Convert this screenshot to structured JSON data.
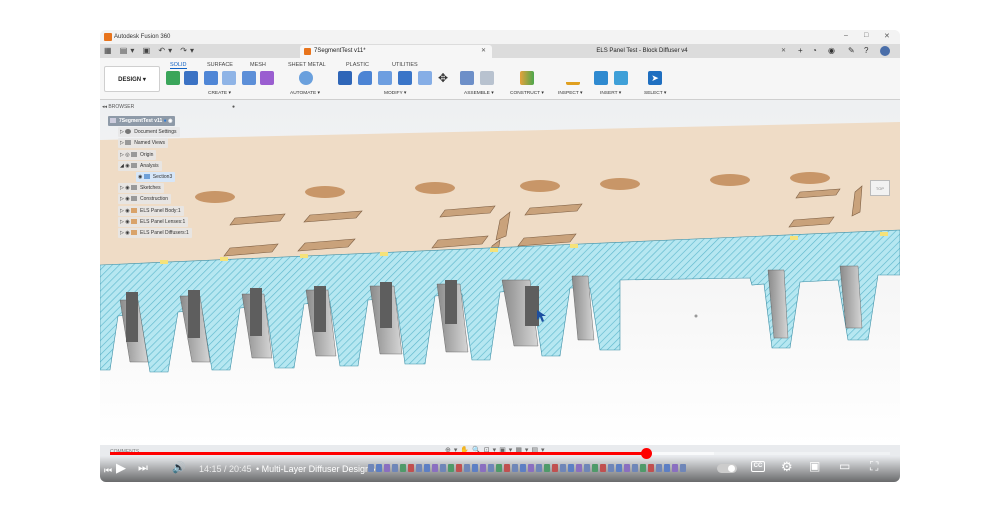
{
  "window": {
    "app_title": "Autodesk Fusion 360"
  },
  "tabs": [
    {
      "label": "7SegmentTest v11*",
      "active": true
    },
    {
      "label": "ELS Panel Test - Block Diffuser v4",
      "active": false
    }
  ],
  "ribbon": {
    "workspace": "DESIGN",
    "tabs": [
      "SOLID",
      "SURFACE",
      "MESH",
      "SHEET METAL",
      "PLASTIC",
      "UTILITIES"
    ],
    "groups": [
      "CREATE",
      "AUTOMATE",
      "MODIFY",
      "ASSEMBLE",
      "CONSTRUCT",
      "INSPECT",
      "INSERT",
      "SELECT"
    ]
  },
  "browser": {
    "title": "BROWSER",
    "root": "7SegmentTest v11",
    "items": [
      "Document Settings",
      "Named Views",
      "Origin",
      "Analysis",
      "Section3",
      "Sketches",
      "Construction",
      "ELS Panel Body:1",
      "ELS Panel Lenses:1",
      "ELS Panel Diffusers:1"
    ]
  },
  "comments_label": "COMMENTS",
  "video": {
    "time": "14:15 / 20:45",
    "chapter": "• Multi-Layer Diffuser Design",
    "progress_fraction": 0.687,
    "buffered_fraction": 0.775
  },
  "icons": {
    "play": "play-icon",
    "next": "next-icon",
    "prev": "previous-icon",
    "volume": "volume-icon",
    "settings": "gear-icon",
    "miniplayer": "miniplayer-icon",
    "theater": "theater-icon",
    "fullscreen": "fullscreen-icon"
  },
  "colors": {
    "accent": "#ff0000",
    "panel_top": "#efd9c2",
    "section_fill": "#a9e0ec",
    "segment_fill": "#c8a27c",
    "ribbon_blue": "#0e61c4"
  }
}
